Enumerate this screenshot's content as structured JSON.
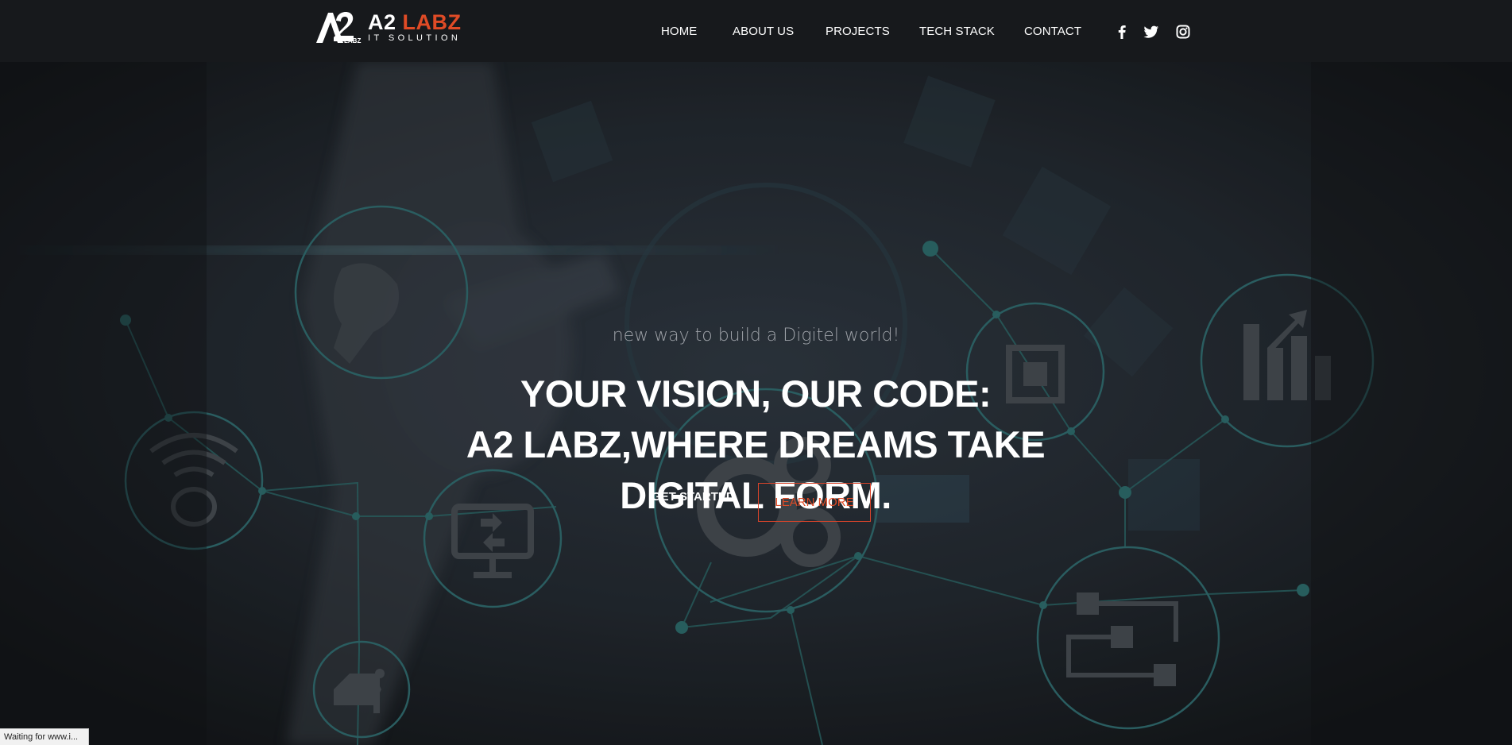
{
  "header": {
    "logo": {
      "word1": "A2",
      "word2": "LABZ",
      "tagline": "IT SOLUTION",
      "mark_text": "LABZ"
    },
    "nav": [
      {
        "label": "HOME"
      },
      {
        "label": "ABOUT US"
      },
      {
        "label": "PROJECTS"
      },
      {
        "label": "TECH STACK"
      },
      {
        "label": "CONTACT"
      }
    ],
    "social": [
      "facebook-icon",
      "twitter-icon",
      "instagram-icon"
    ]
  },
  "hero": {
    "subtitle": "new way to build a Digitel world!",
    "title_lines": [
      "YOUR VISION, OUR CODE:",
      "A2 LABZ,WHERE DREAMS TAKE",
      "DIGITAL FORM."
    ],
    "get_started": "GET STARTED",
    "learn_more": "LEARN MORE"
  },
  "status_bar": {
    "text": "Waiting for www.i..."
  },
  "colors": {
    "accent": "#e04b26",
    "header_bg": "#17191c",
    "hero_overlay": "#1a1d22",
    "network_teal": "#2c6a6a",
    "text_white": "#ffffff",
    "subtitle_gray": "#9ea2a8"
  }
}
